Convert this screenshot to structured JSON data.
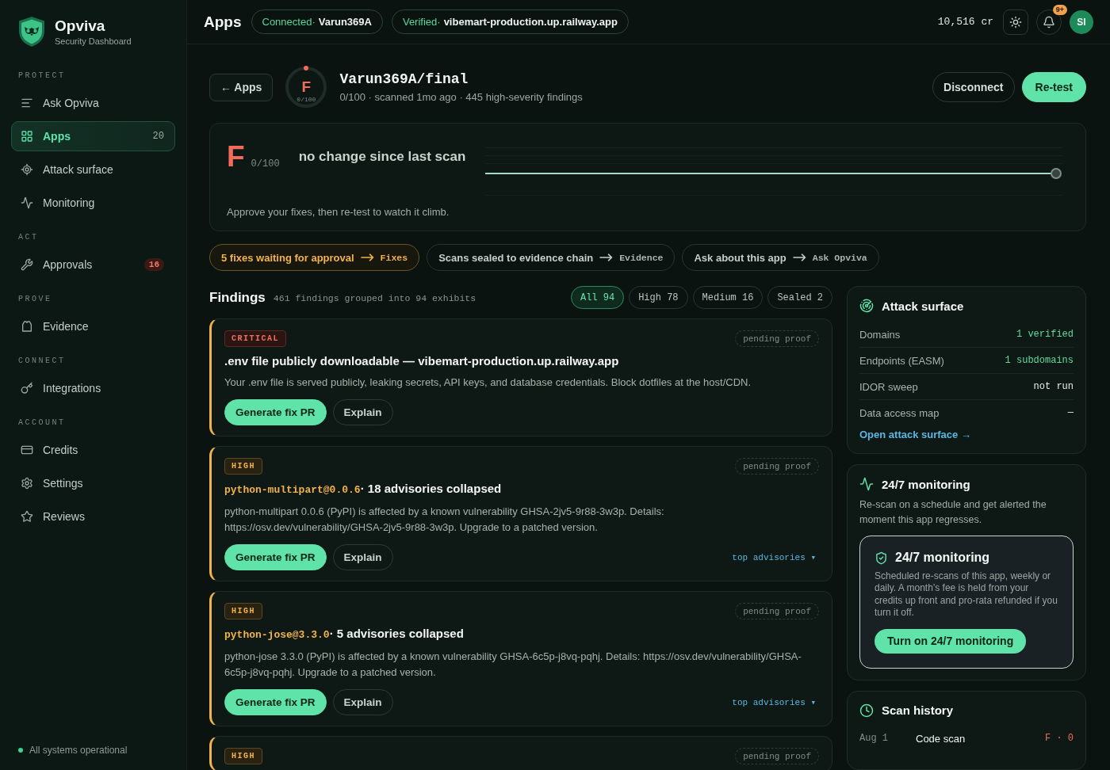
{
  "sidebar": {
    "brand": {
      "name": "Opviva",
      "tagline": "Security Dashboard"
    },
    "sections": [
      {
        "label": "PROTECT",
        "items": [
          {
            "label": "Ask Opviva",
            "selected": false
          },
          {
            "label": "Apps",
            "selected": true,
            "count": {
              "text": "20",
              "kind": "plain"
            }
          },
          {
            "label": "Attack surface",
            "selected": false
          },
          {
            "label": "Monitoring",
            "selected": false
          }
        ]
      },
      {
        "label": "ACT",
        "items": [
          {
            "label": "Approvals",
            "selected": false,
            "count": {
              "text": "16",
              "kind": "alert"
            }
          }
        ]
      },
      {
        "label": "PROVE",
        "items": [
          {
            "label": "Evidence",
            "selected": false
          }
        ]
      },
      {
        "label": "CONNECT",
        "items": [
          {
            "label": "Integrations",
            "selected": false
          }
        ]
      },
      {
        "label": "ACCOUNT",
        "items": [
          {
            "label": "Credits",
            "selected": false
          },
          {
            "label": "Settings",
            "selected": false
          },
          {
            "label": "Reviews",
            "selected": false
          }
        ]
      }
    ],
    "status": {
      "text": "All systems operational",
      "ok": true
    }
  },
  "topbar": {
    "title": "Apps",
    "pills": [
      {
        "label": "Connected·",
        "value": "Varun369A"
      },
      {
        "label": "Verified·",
        "value": "vibemart-production.up.railway.app"
      }
    ],
    "credits": "10,516 cr",
    "notifications": "9+",
    "avatar": "SI"
  },
  "app": {
    "back": "← Apps",
    "grade": {
      "letter": "F",
      "score": "0/100"
    },
    "title": "Varun369A/final",
    "meta": "0/100 · scanned 1mo ago · 445 high-severity findings",
    "actions": [
      {
        "label": "Disconnect",
        "kind": "secondary"
      },
      {
        "label": "Re-test",
        "kind": "primary"
      }
    ]
  },
  "score": {
    "grade": "F",
    "score": "0/100",
    "trend": "no change since last scan",
    "hint": "Approve your fixes, then re-test to watch it climb."
  },
  "shortcuts": [
    {
      "text": "5 fixes waiting for approval",
      "target": "Fixes",
      "kind": "warning"
    },
    {
      "text": "Scans sealed to evidence chain",
      "target": "Evidence",
      "kind": "plain"
    },
    {
      "text": "Ask about this app",
      "target": "Ask Opviva",
      "kind": "plain"
    }
  ],
  "findings": {
    "title": "Findings",
    "summary": "461 findings grouped into 94 exhibits",
    "filters": [
      {
        "label": "All 94",
        "selected": true
      },
      {
        "label": "High 78",
        "selected": false
      },
      {
        "label": "Medium 16",
        "selected": false
      },
      {
        "label": "Sealed 2",
        "selected": false
      }
    ],
    "items": [
      {
        "severity": "CRITICAL",
        "kind": "critical",
        "status": "pending proof",
        "title": ".env file publicly downloadable — vibemart-production.up.railway.app",
        "description": "Your .env file is served publicly, leaking secrets, API keys, and database credentials. Block dotfiles at the host/CDN.",
        "actions": [
          {
            "label": "Generate fix PR",
            "kind": "primary"
          },
          {
            "label": "Explain",
            "kind": "secondary"
          }
        ]
      },
      {
        "severity": "HIGH",
        "kind": "high",
        "status": "pending proof",
        "package": "python-multipart@0.0.6",
        "title": "· 18 advisories collapsed",
        "description": "python-multipart 0.0.6 (PyPI) is affected by a known vulnerability GHSA-2jv5-9r88-3w3p. Details: https://osv.dev/vulnerability/GHSA-2jv5-9r88-3w3p. Upgrade to a patched version.",
        "actions": [
          {
            "label": "Generate fix PR",
            "kind": "primary"
          },
          {
            "label": "Explain",
            "kind": "secondary"
          }
        ],
        "more": "top advisories ▾"
      },
      {
        "severity": "HIGH",
        "kind": "high",
        "status": "pending proof",
        "package": "python-jose@3.3.0",
        "title": "· 5 advisories collapsed",
        "description": "python-jose 3.3.0 (PyPI) is affected by a known vulnerability GHSA-6c5p-j8vq-pqhj. Details: https://osv.dev/vulnerability/GHSA-6c5p-j8vq-pqhj. Upgrade to a patched version.",
        "actions": [
          {
            "label": "Generate fix PR",
            "kind": "primary"
          },
          {
            "label": "Explain",
            "kind": "secondary"
          }
        ],
        "more": "top advisories ▾"
      },
      {
        "severity": "HIGH",
        "kind": "high",
        "status": "pending proof"
      }
    ]
  },
  "attack_surface": {
    "title": "Attack surface",
    "rows": [
      {
        "label": "Domains",
        "value": "1 verified",
        "kind": "positive"
      },
      {
        "label": "Endpoints (EASM)",
        "value": "1 subdomains",
        "kind": "positive"
      },
      {
        "label": "IDOR sweep",
        "value": "not run",
        "kind": "neutral"
      },
      {
        "label": "Data access map",
        "value": "—",
        "kind": "neutral"
      }
    ],
    "link": "Open attack surface →"
  },
  "monitoring": {
    "title": "24/7 monitoring",
    "description": "Re-scan on a schedule and get alerted the moment this app regresses.",
    "offer": {
      "title": "24/7 monitoring",
      "description": "Scheduled re-scans of this app, weekly or daily. A month’s fee is held from your credits up front and pro-rata refunded if you turn it off.",
      "button": "Turn on 24/7 monitoring"
    }
  },
  "scan_history": {
    "title": "Scan history",
    "rows": [
      {
        "date": "Aug 1",
        "type": "Code scan",
        "result": "F · 0"
      }
    ]
  }
}
